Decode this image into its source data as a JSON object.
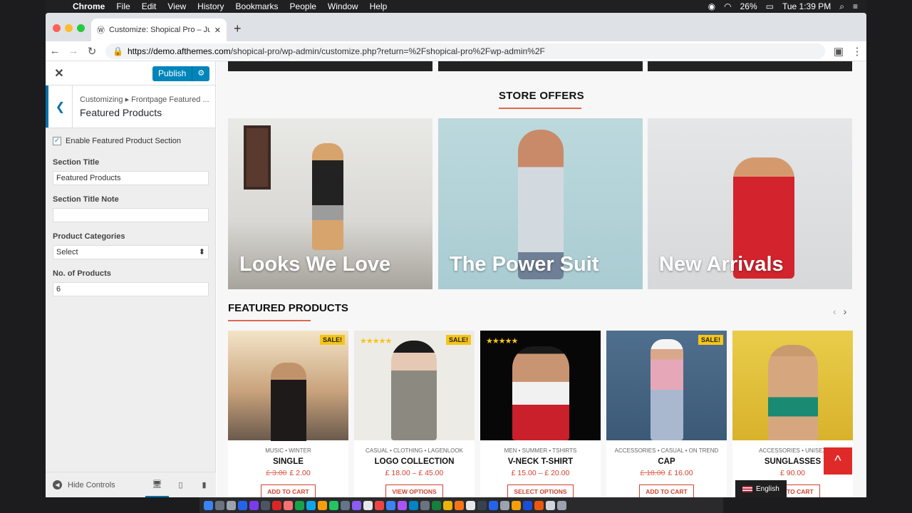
{
  "menubar": {
    "app": "Chrome",
    "items": [
      "File",
      "Edit",
      "View",
      "History",
      "Bookmarks",
      "People",
      "Window",
      "Help"
    ],
    "battery": "26%",
    "time": "Tue 1:39 PM"
  },
  "browser": {
    "tab_title": "Customize: Shopical Pro – Just",
    "url_domain": "https://demo.afthemes.com",
    "url_path": "/shopical-pro/wp-admin/customize.php?return=%2Fshopical-pro%2Fwp-admin%2F"
  },
  "customizer": {
    "publish_label": "Publish",
    "breadcrumb": "Customizing ▸ Frontpage Featured ...",
    "section_title": "Featured Products",
    "enable_label": "Enable Featured Product Section",
    "section_title_label": "Section Title",
    "section_title_value": "Featured Products",
    "note_label": "Section Title Note",
    "note_value": "",
    "categories_label": "Product Categories",
    "categories_value": "Select",
    "count_label": "No. of Products",
    "count_value": "6",
    "hide_controls": "Hide Controls"
  },
  "preview": {
    "store_offers_title": "STORE OFFERS",
    "offers": [
      "Looks We Love",
      "The Power Suit",
      "New Arrivals"
    ],
    "featured_title": "FEATURED PRODUCTS",
    "products": [
      {
        "cats": "MUSIC • WINTER",
        "name": "SINGLE",
        "old": "£ 3.00",
        "price": "£ 2.00",
        "button": "ADD TO CART",
        "sale": "SALE!",
        "rating": ""
      },
      {
        "cats": "CASUAL • CLOTHING • LAGENLOOK",
        "name": "LOGO COLLECTION",
        "old": "",
        "price": "£ 18.00 – £ 45.00",
        "button": "VIEW OPTIONS",
        "sale": "SALE!",
        "rating": "★★★★★"
      },
      {
        "cats": "MEN • SUMMER • TSHIRTS",
        "name": "V-NECK T-SHIRT",
        "old": "",
        "price": "£ 15.00 – £ 20.00",
        "button": "SELECT OPTIONS",
        "sale": "",
        "rating": "★★★★★"
      },
      {
        "cats": "ACCESSORIES • CASUAL • ON TREND",
        "name": "CAP",
        "old": "£ 18.00",
        "price": "£ 16.00",
        "button": "ADD TO CART",
        "sale": "SALE!",
        "rating": ""
      },
      {
        "cats": "ACCESSORIES • UNISEX",
        "name": "SUNGLASSES",
        "old": "",
        "price": "£ 90.00",
        "button": "ADD TO CART",
        "sale": "",
        "rating": ""
      }
    ],
    "language": "English"
  },
  "colors": {
    "accent": "#e06651",
    "wp_blue": "#0085ba",
    "sale": "#f5c518",
    "to_top": "#e02a2a"
  }
}
